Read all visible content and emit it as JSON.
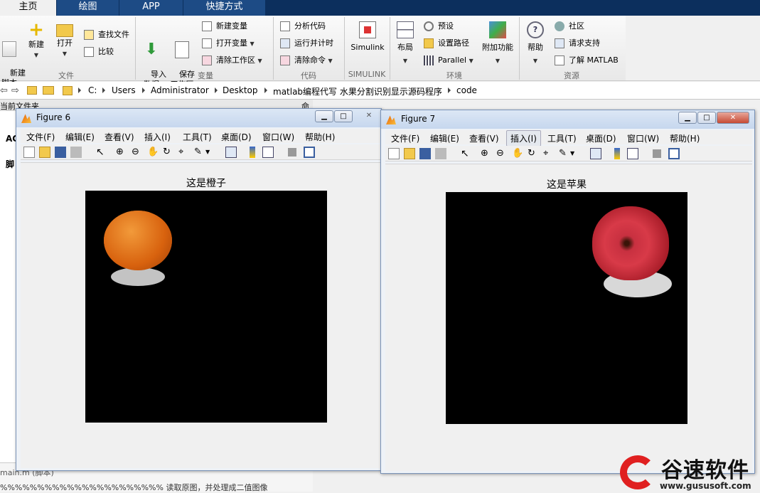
{
  "ribbon_tabs": [
    {
      "label": "主页",
      "active": true
    },
    {
      "label": "绘图",
      "active": false
    },
    {
      "label": "APP",
      "active": false
    },
    {
      "label": "快捷方式",
      "active": false
    }
  ],
  "ribbon": {
    "file": {
      "new_script": "新建\n脚本",
      "new": "新建",
      "open": "打开",
      "find_files": "查找文件",
      "compare": "比较",
      "group": "文件"
    },
    "variable": {
      "import": "导入\n数据",
      "save": "保存\n工作区",
      "new_var": "新建变量",
      "open_var": "打开变量",
      "clear_ws": "清除工作区",
      "group": "变量"
    },
    "code": {
      "analyze": "分析代码",
      "run_time": "运行并计时",
      "clear_cmd": "清除命令",
      "group": "代码"
    },
    "simulink": {
      "label": "Simulink",
      "group": "SIMULINK"
    },
    "env": {
      "layout": "布局",
      "prefs": "预设",
      "set_path": "设置路径",
      "parallel": "Parallel",
      "addons": "附加功能",
      "group": "环境"
    },
    "resources": {
      "help": "帮助",
      "community": "社区",
      "support": "请求支持",
      "learn": "了解 MATLAB",
      "group": "资源"
    }
  },
  "address": {
    "drive": "C:",
    "path": [
      "Users",
      "Administrator",
      "Desktop",
      "matlab编程代写 水果分割识别显示源码程序",
      "code"
    ]
  },
  "left_panel": {
    "current_folder": "当前文件夹",
    "command_window": "命令行窗口",
    "item1": "AC",
    "item2": "脚",
    "bottom_file": "main.m (脚本)",
    "bottom_code": "%%%%%%%%%%%%%%%%%%%%%% 读取原图，并处理成二值图像"
  },
  "menus": [
    "文件(F)",
    "编辑(E)",
    "查看(V)",
    "插入(I)",
    "工具(T)",
    "桌面(D)",
    "窗口(W)",
    "帮助(H)"
  ],
  "figures": [
    {
      "title": "Figure 6",
      "axes_title": "这是橙子"
    },
    {
      "title": "Figure 7",
      "axes_title": "这是苹果"
    }
  ],
  "watermark": {
    "name": "谷速软件",
    "url": "www.gususoft.com"
  }
}
